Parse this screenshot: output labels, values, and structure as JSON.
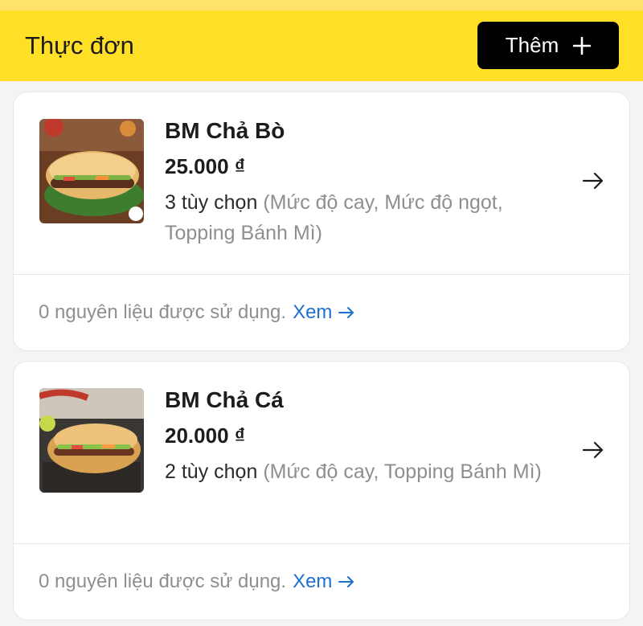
{
  "header": {
    "title": "Thực đơn",
    "add_label": "Thêm"
  },
  "colors": {
    "header_bg": "#ffe026",
    "link": "#1f6fd1",
    "button_bg": "#000000"
  },
  "items": [
    {
      "name": "BM Chả Bò",
      "price": "25.000 ₫",
      "options_count": "3 tùy chọn",
      "options_list": "(Mức độ cay, Mức độ ngọt, Topping Bánh Mì)",
      "ingredients_text": "0 nguyên liệu được sử dụng.",
      "view_label": "Xem",
      "image_icon": "banh-mi-photo"
    },
    {
      "name": "BM Chả Cá",
      "price": "20.000 ₫",
      "options_count": "2 tùy chọn",
      "options_list": "(Mức độ cay, Topping Bánh Mì)",
      "ingredients_text": "0 nguyên liệu được sử dụng.",
      "view_label": "Xem",
      "image_icon": "banh-mi-photo"
    }
  ]
}
